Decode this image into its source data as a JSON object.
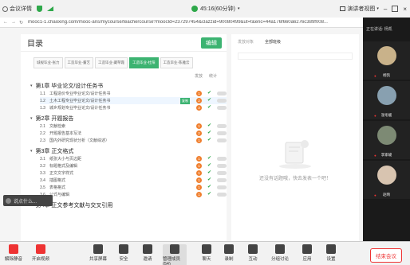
{
  "meeting": {
    "title": "会议详情",
    "timer": "45:16(60分钟)",
    "view_label": "演讲者视图",
    "end_label": "结束会议"
  },
  "browser": {
    "url": "mooc1-1.chaoxing.com/mooc-ans/mycourse/teachercourse?moocId=237297454&clazzid=90080499&ut=t&enc=44a176f660a6276c389f008..."
  },
  "outline": {
    "title": "目录",
    "edit_label": "编辑",
    "tabs": [
      "城规毕业-张力",
      "工造毕业-董艺",
      "工造毕业-藏琴霞",
      "工造毕业-杜阳",
      "工造毕业-陈雅云"
    ],
    "active_tab": 3,
    "col_publish": "发放",
    "col_stats": "统计",
    "chapters": [
      {
        "title": "第1章  毕业论文/设计任务书",
        "sections": [
          {
            "num": "1.1",
            "title": "工程造价专业毕业论文/设计任务书",
            "count": "1"
          },
          {
            "num": "1.2",
            "title": "土木工程专业毕业论文/设计任务书",
            "count": "2",
            "badge": "复制"
          },
          {
            "num": "1.3",
            "title": "城乡规划专业毕业论文/设计任务书",
            "count": "3"
          }
        ]
      },
      {
        "title": "第2章  开题报告",
        "sections": [
          {
            "num": "2.1",
            "title": "文献检索",
            "count": "1"
          },
          {
            "num": "2.2",
            "title": "开题报告基本写法",
            "count": "2"
          },
          {
            "num": "2.3",
            "title": "国内外研究现状分析（文献综述）",
            "count": "1"
          }
        ]
      },
      {
        "title": "第3章  正文格式",
        "sections": [
          {
            "num": "3.1",
            "title": "纸张大小与页边距",
            "count": "1"
          },
          {
            "num": "3.2",
            "title": "标题格式及编辑",
            "count": "1"
          },
          {
            "num": "3.3",
            "title": "正文文字样式",
            "count": "1"
          },
          {
            "num": "3.4",
            "title": "插图格式",
            "count": "1"
          },
          {
            "num": "3.5",
            "title": "表格格式",
            "count": "1"
          },
          {
            "num": "3.6",
            "title": "公式与编辑",
            "count": "1"
          }
        ]
      },
      {
        "title": "第4章  正文参考文献与交叉引用",
        "sections": []
      }
    ]
  },
  "discussion": {
    "tab_my": "发放对象",
    "tab_all": "全部班级",
    "empty_text": "还没有话题哦，快去发表一个吧！"
  },
  "chat_popup": {
    "text": "说点什么..."
  },
  "gallery": {
    "header": "正在讲话: 杨凯",
    "participants": [
      {
        "name": "杨凯",
        "color": "#c9b28a"
      },
      {
        "name": "温冬媛",
        "color": "#88a0b0"
      },
      {
        "name": "李家峻",
        "color": "#7d8a74"
      },
      {
        "name": "赵晴",
        "color": "#d8c4b0"
      }
    ]
  },
  "toolbar": {
    "buttons": [
      {
        "label": "解除静音",
        "icon": "mic-muted-icon",
        "red": true
      },
      {
        "label": "开启视频",
        "icon": "video-off-icon",
        "red": true
      },
      {
        "label": "共享屏幕",
        "icon": "share-screen-icon"
      },
      {
        "label": "安全",
        "icon": "shield-icon"
      },
      {
        "label": "邀请",
        "icon": "invite-icon"
      },
      {
        "label": "管理成员(54)",
        "icon": "members-icon",
        "highlight": true
      },
      {
        "label": "聊天",
        "icon": "chat-icon"
      },
      {
        "label": "录制",
        "icon": "record-icon"
      },
      {
        "label": "互动",
        "icon": "reaction-icon"
      },
      {
        "label": "分组讨论",
        "icon": "breakout-icon"
      },
      {
        "label": "应用",
        "icon": "apps-icon"
      },
      {
        "label": "设置",
        "icon": "settings-icon"
      }
    ]
  }
}
